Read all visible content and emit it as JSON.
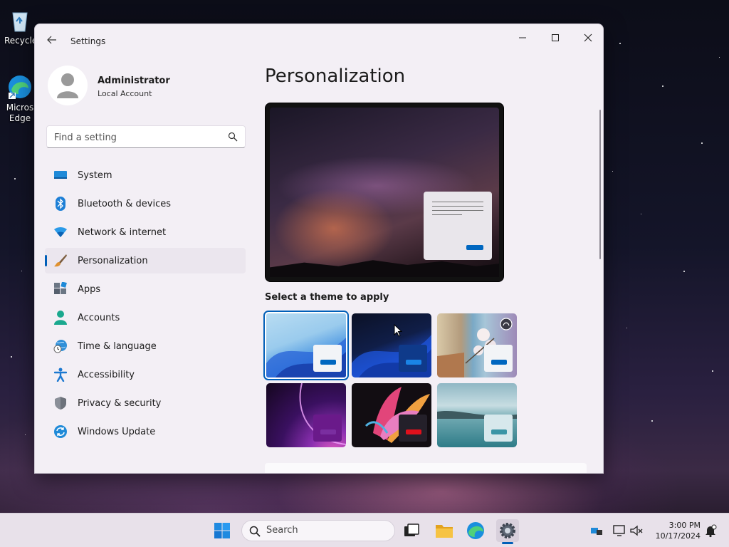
{
  "desktop": {
    "icons": [
      {
        "label": "Recycle"
      },
      {
        "label": "Micros Edge"
      }
    ]
  },
  "window": {
    "title": "Settings",
    "controls": {
      "minimize": "─",
      "maximize": "☐",
      "close": "✕"
    }
  },
  "profile": {
    "name": "Administrator",
    "account_type": "Local Account"
  },
  "search": {
    "placeholder": "Find a setting"
  },
  "nav": {
    "items": [
      {
        "label": "System",
        "icon": "system-icon"
      },
      {
        "label": "Bluetooth & devices",
        "icon": "bluetooth-icon"
      },
      {
        "label": "Network & internet",
        "icon": "wifi-icon"
      },
      {
        "label": "Personalization",
        "icon": "brush-icon",
        "active": true
      },
      {
        "label": "Apps",
        "icon": "apps-icon"
      },
      {
        "label": "Accounts",
        "icon": "accounts-icon"
      },
      {
        "label": "Time & language",
        "icon": "clock-globe-icon"
      },
      {
        "label": "Accessibility",
        "icon": "accessibility-icon"
      },
      {
        "label": "Privacy & security",
        "icon": "shield-icon"
      },
      {
        "label": "Windows Update",
        "icon": "update-icon"
      }
    ]
  },
  "content": {
    "page_title": "Personalization",
    "theme_caption": "Select a theme to apply",
    "themes": [
      {
        "name": "windows-light",
        "selected": true
      },
      {
        "name": "windows-dark",
        "selected": false
      },
      {
        "name": "glow-spring",
        "selected": false
      },
      {
        "name": "glow",
        "selected": false
      },
      {
        "name": "captured-motion",
        "selected": false
      },
      {
        "name": "flow",
        "selected": false
      }
    ]
  },
  "taskbar": {
    "search_label": "Search",
    "time": "3:00 PM",
    "date": "10/17/2024",
    "apps": [
      "start-icon",
      "task-view-icon",
      "file-explorer-icon",
      "edge-icon",
      "settings-icon"
    ]
  },
  "colors": {
    "accent": "#005fb8",
    "window_bg": "#f3eff5",
    "taskbar_bg": "#e8e1ea"
  }
}
